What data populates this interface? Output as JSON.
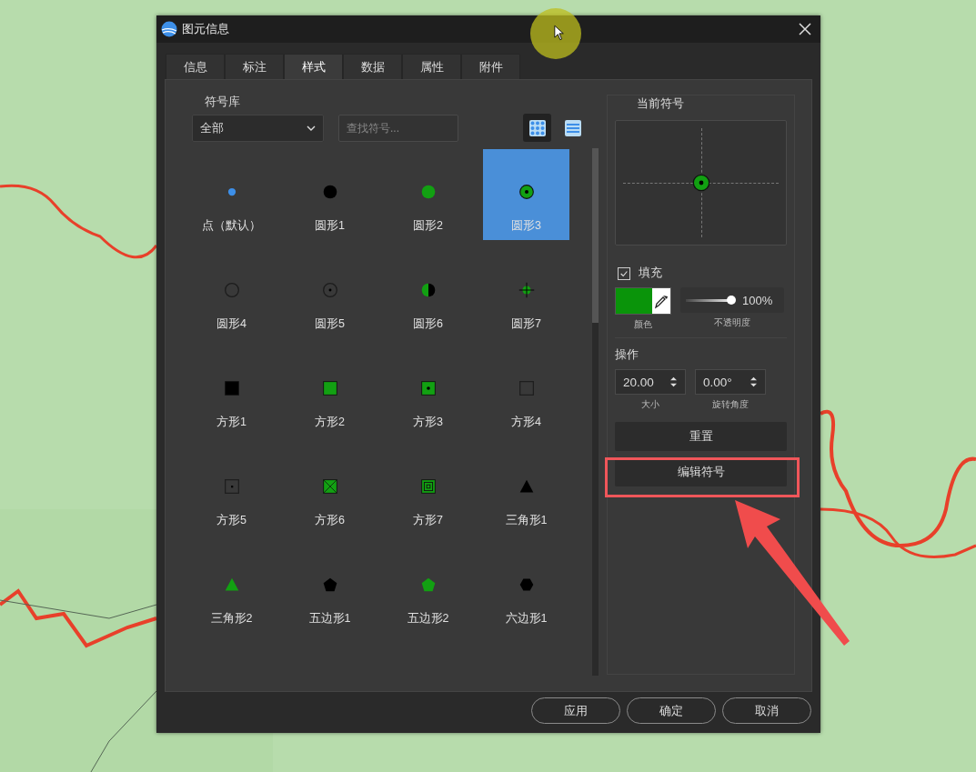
{
  "window": {
    "title": "图元信息"
  },
  "tabs": [
    {
      "label": "信息",
      "selected": false
    },
    {
      "label": "标注",
      "selected": false
    },
    {
      "label": "样式",
      "selected": true
    },
    {
      "label": "数据",
      "selected": false
    },
    {
      "label": "属性",
      "selected": false
    },
    {
      "label": "附件",
      "selected": false
    }
  ],
  "symbol_library": {
    "title": "符号库",
    "category": "全部",
    "search": {
      "placeholder": "查找符号..."
    },
    "view_modes": [
      {
        "kind": "grid",
        "selected": true
      },
      {
        "kind": "list",
        "selected": false
      }
    ],
    "symbols": [
      {
        "label": "点（默认）",
        "kind": "dot",
        "color": "#3d8fe8",
        "selected": false
      },
      {
        "label": "圆形1",
        "kind": "disc",
        "color": "#000000",
        "selected": false
      },
      {
        "label": "圆形2",
        "kind": "disc",
        "color": "#12a012",
        "selected": false
      },
      {
        "label": "圆形3",
        "kind": "ring-dot",
        "color": "#12a012",
        "selected": true
      },
      {
        "label": "圆形4",
        "kind": "ring",
        "color": "#1c1c1c",
        "selected": false
      },
      {
        "label": "圆形5",
        "kind": "ring-center",
        "color": "#1c1c1c",
        "selected": false
      },
      {
        "label": "圆形6",
        "kind": "half",
        "color": "#12a012",
        "selected": false
      },
      {
        "label": "圆形7",
        "kind": "crosshair",
        "color": "#12a012",
        "selected": false
      },
      {
        "label": "方形1",
        "kind": "square",
        "color": "#000000",
        "selected": false
      },
      {
        "label": "方形2",
        "kind": "square",
        "color": "#12a012",
        "selected": false
      },
      {
        "label": "方形3",
        "kind": "square-dot",
        "color": "#12a012",
        "selected": false
      },
      {
        "label": "方形4",
        "kind": "square-outline",
        "color": "#1c1c1c",
        "selected": false
      },
      {
        "label": "方形5",
        "kind": "square-outline-dot",
        "color": "#1c1c1c",
        "selected": false
      },
      {
        "label": "方形6",
        "kind": "square-x",
        "color": "#12a012",
        "selected": false
      },
      {
        "label": "方形7",
        "kind": "square-nested",
        "color": "#12a012",
        "selected": false
      },
      {
        "label": "三角形1",
        "kind": "triangle",
        "color": "#000000",
        "selected": false
      },
      {
        "label": "三角形2",
        "kind": "triangle",
        "color": "#12a012",
        "selected": false
      },
      {
        "label": "五边形1",
        "kind": "pentagon",
        "color": "#000000",
        "selected": false
      },
      {
        "label": "五边形2",
        "kind": "pentagon",
        "color": "#12a012",
        "selected": false
      },
      {
        "label": "六边形1",
        "kind": "hexagon",
        "color": "#000000",
        "selected": false
      }
    ]
  },
  "current_symbol": {
    "title": "当前符号",
    "fill": {
      "label": "填充",
      "checked": true,
      "color": "#0a940a",
      "color_caption": "颜色",
      "opacity": {
        "level": 1,
        "reading": "100%"
      },
      "opacity_caption": "不透明度"
    },
    "operation": {
      "title": "操作",
      "size": {
        "value": "20.00",
        "caption": "大小"
      },
      "rotation": {
        "value": "0.00°",
        "caption": "旋转角度"
      }
    },
    "buttons": [
      "重置",
      "编辑符号"
    ]
  },
  "footer_buttons": [
    "应用",
    "确定",
    "取消"
  ]
}
